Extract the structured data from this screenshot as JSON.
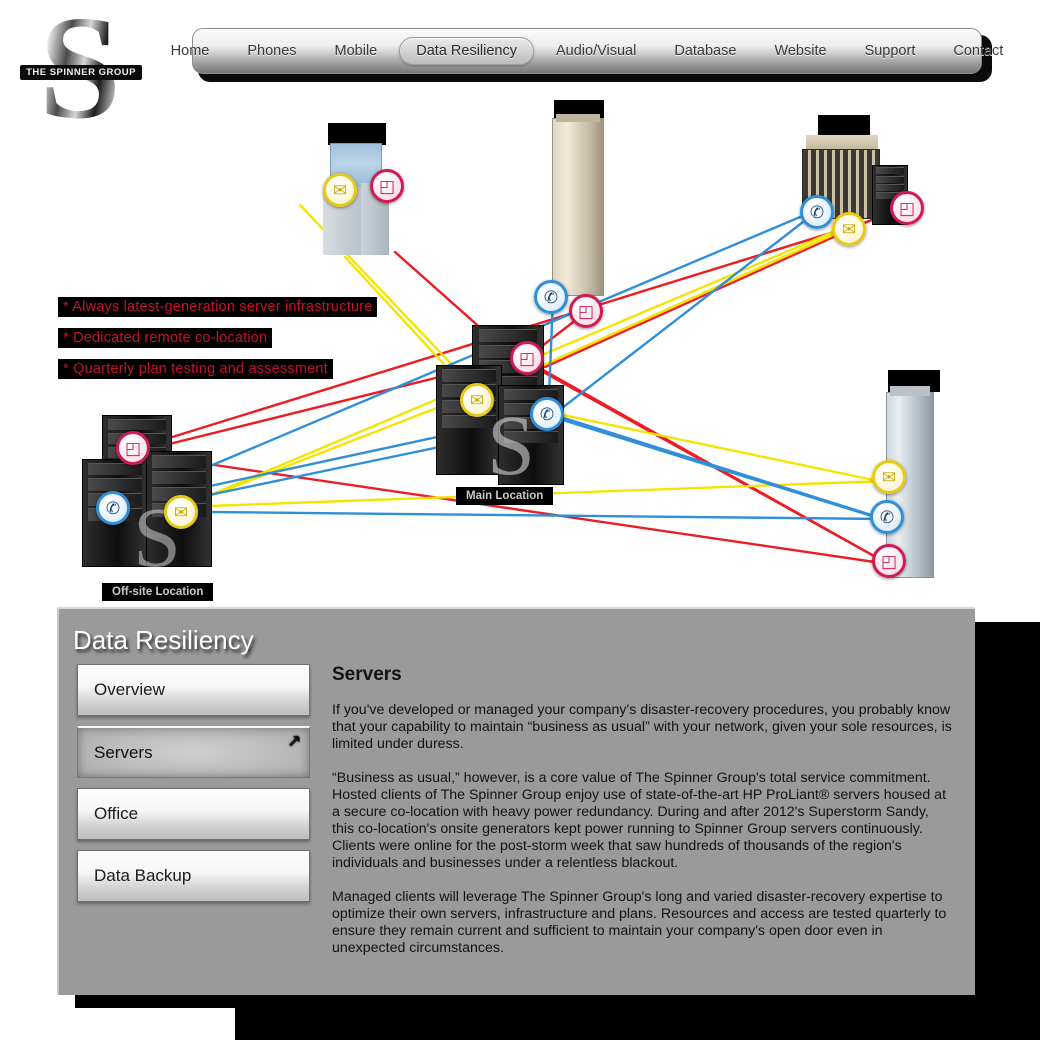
{
  "brand": {
    "letter": "S",
    "wordmark": "THE SPINNER GROUP"
  },
  "nav": {
    "items": [
      {
        "label": "Home",
        "active": false
      },
      {
        "label": "Phones",
        "active": false
      },
      {
        "label": "Mobile",
        "active": false
      },
      {
        "label": "Data Resiliency",
        "active": true
      },
      {
        "label": "Audio/Visual",
        "active": false
      },
      {
        "label": "Database",
        "active": false
      },
      {
        "label": "Website",
        "active": false
      },
      {
        "label": "Support",
        "active": false
      },
      {
        "label": "Contact",
        "active": false
      }
    ]
  },
  "diagram": {
    "bullets": [
      "* Always latest-generation server infrastructure",
      "* Dedicated remote co-location",
      "* Quarterly plan testing and assessment"
    ],
    "site_labels": {
      "main": "Main Location",
      "offsite": "Off-site Location"
    },
    "badge_icons": {
      "folder": "folder-icon",
      "mail": "envelope-icon",
      "phone": "mobile-phone-icon"
    },
    "link_colors": {
      "data": "#ec1c24",
      "mail": "#f5e400",
      "voice": "#2f8fd8"
    },
    "glyphs": {
      "folder": "◰",
      "mail": "✉",
      "phone": "✆"
    }
  },
  "panel": {
    "title": "Data Resiliency",
    "menu": [
      {
        "label": "Overview",
        "selected": false
      },
      {
        "label": "Servers",
        "selected": true
      },
      {
        "label": "Office",
        "selected": false
      },
      {
        "label": "Data Backup",
        "selected": false
      }
    ],
    "cursor_glyph": "↗",
    "article": {
      "heading": "Servers",
      "paragraphs": [
        "If you've developed or managed your company's disaster-recovery procedures, you probably know that your capability to maintain “business as usual” with your network, given your sole resources, is limited under duress.",
        "“Business as usual,” however, is a core value of The Spinner Group's total service commitment. Hosted clients of The Spinner Group enjoy use of state-of-the-art HP ProLiant® servers housed at a secure co-location with heavy power redundancy.  During and after 2012's Superstorm Sandy, this co-location's onsite generators kept power running to Spinner Group servers continuously.  Clients were online for the post-storm week that saw hundreds of thousands of the region's individuals and businesses under a relentless blackout.",
        "Managed clients will leverage The Spinner Group's long and varied disaster-recovery expertise to optimize their own servers, infrastructure and plans.  Resources and access are tested quarterly to ensure they remain current and sufficient to maintain your company's open door even in unexpected circumstances."
      ]
    }
  }
}
